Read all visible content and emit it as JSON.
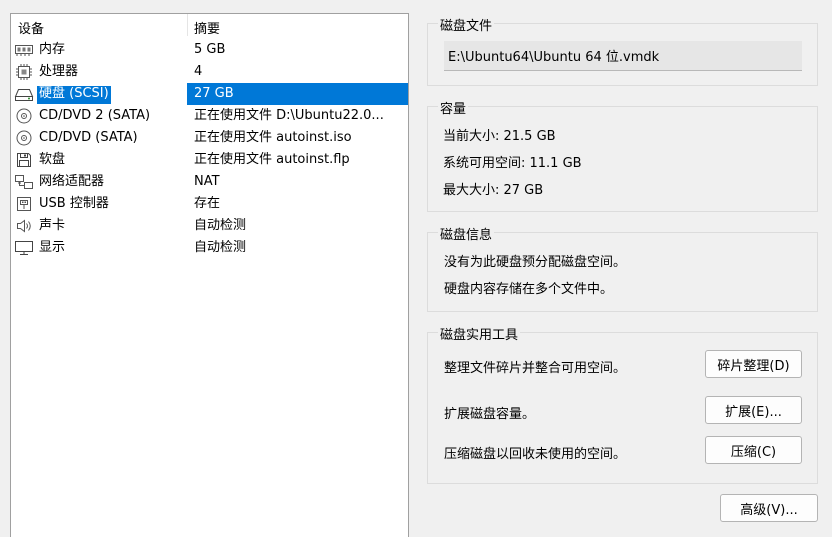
{
  "device_list": {
    "headers": {
      "device": "设备",
      "summary": "摘要"
    },
    "rows": [
      {
        "name": "内存",
        "summary": "5 GB",
        "icon": "memory-icon"
      },
      {
        "name": "处理器",
        "summary": "4",
        "icon": "processor-icon"
      },
      {
        "name": "硬盘 (SCSI)",
        "summary": "27 GB",
        "icon": "hard-disk-icon",
        "selected": true
      },
      {
        "name": "CD/DVD 2 (SATA)",
        "summary": "正在使用文件 D:\\Ubuntu22.0...",
        "icon": "cd-dvd-icon"
      },
      {
        "name": "CD/DVD (SATA)",
        "summary": "正在使用文件 autoinst.iso",
        "icon": "cd-dvd-icon"
      },
      {
        "name": "软盘",
        "summary": "正在使用文件 autoinst.flp",
        "icon": "floppy-icon"
      },
      {
        "name": "网络适配器",
        "summary": "NAT",
        "icon": "network-adapter-icon"
      },
      {
        "name": "USB 控制器",
        "summary": "存在",
        "icon": "usb-icon"
      },
      {
        "name": "声卡",
        "summary": "自动检测",
        "icon": "speaker-icon"
      },
      {
        "name": "显示",
        "summary": "自动检测",
        "icon": "monitor-icon"
      }
    ]
  },
  "disk_file": {
    "title": "磁盘文件",
    "path": "E:\\Ubuntu64\\Ubuntu 64 位.vmdk"
  },
  "capacity": {
    "title": "容量",
    "current_size": "当前大小: 21.5 GB",
    "free_space": "系统可用空间: 11.1 GB",
    "max_size": "最大大小: 27 GB"
  },
  "disk_info": {
    "title": "磁盘信息",
    "line1": "没有为此硬盘预分配磁盘空间。",
    "line2": "硬盘内容存储在多个文件中。"
  },
  "disk_tools": {
    "title": "磁盘实用工具",
    "defrag_desc": "整理文件碎片并整合可用空间。",
    "defrag_label": "碎片整理(D)",
    "expand_desc": "扩展磁盘容量。",
    "expand_label": "扩展(E)...",
    "compact_desc": "压缩磁盘以回收未使用的空间。",
    "compact_label": "压缩(C)"
  },
  "advanced_label": "高级(V)...",
  "colors": {
    "selection": "#0078d7",
    "background": "#f0f0f0",
    "border": "#dcdcdc"
  }
}
